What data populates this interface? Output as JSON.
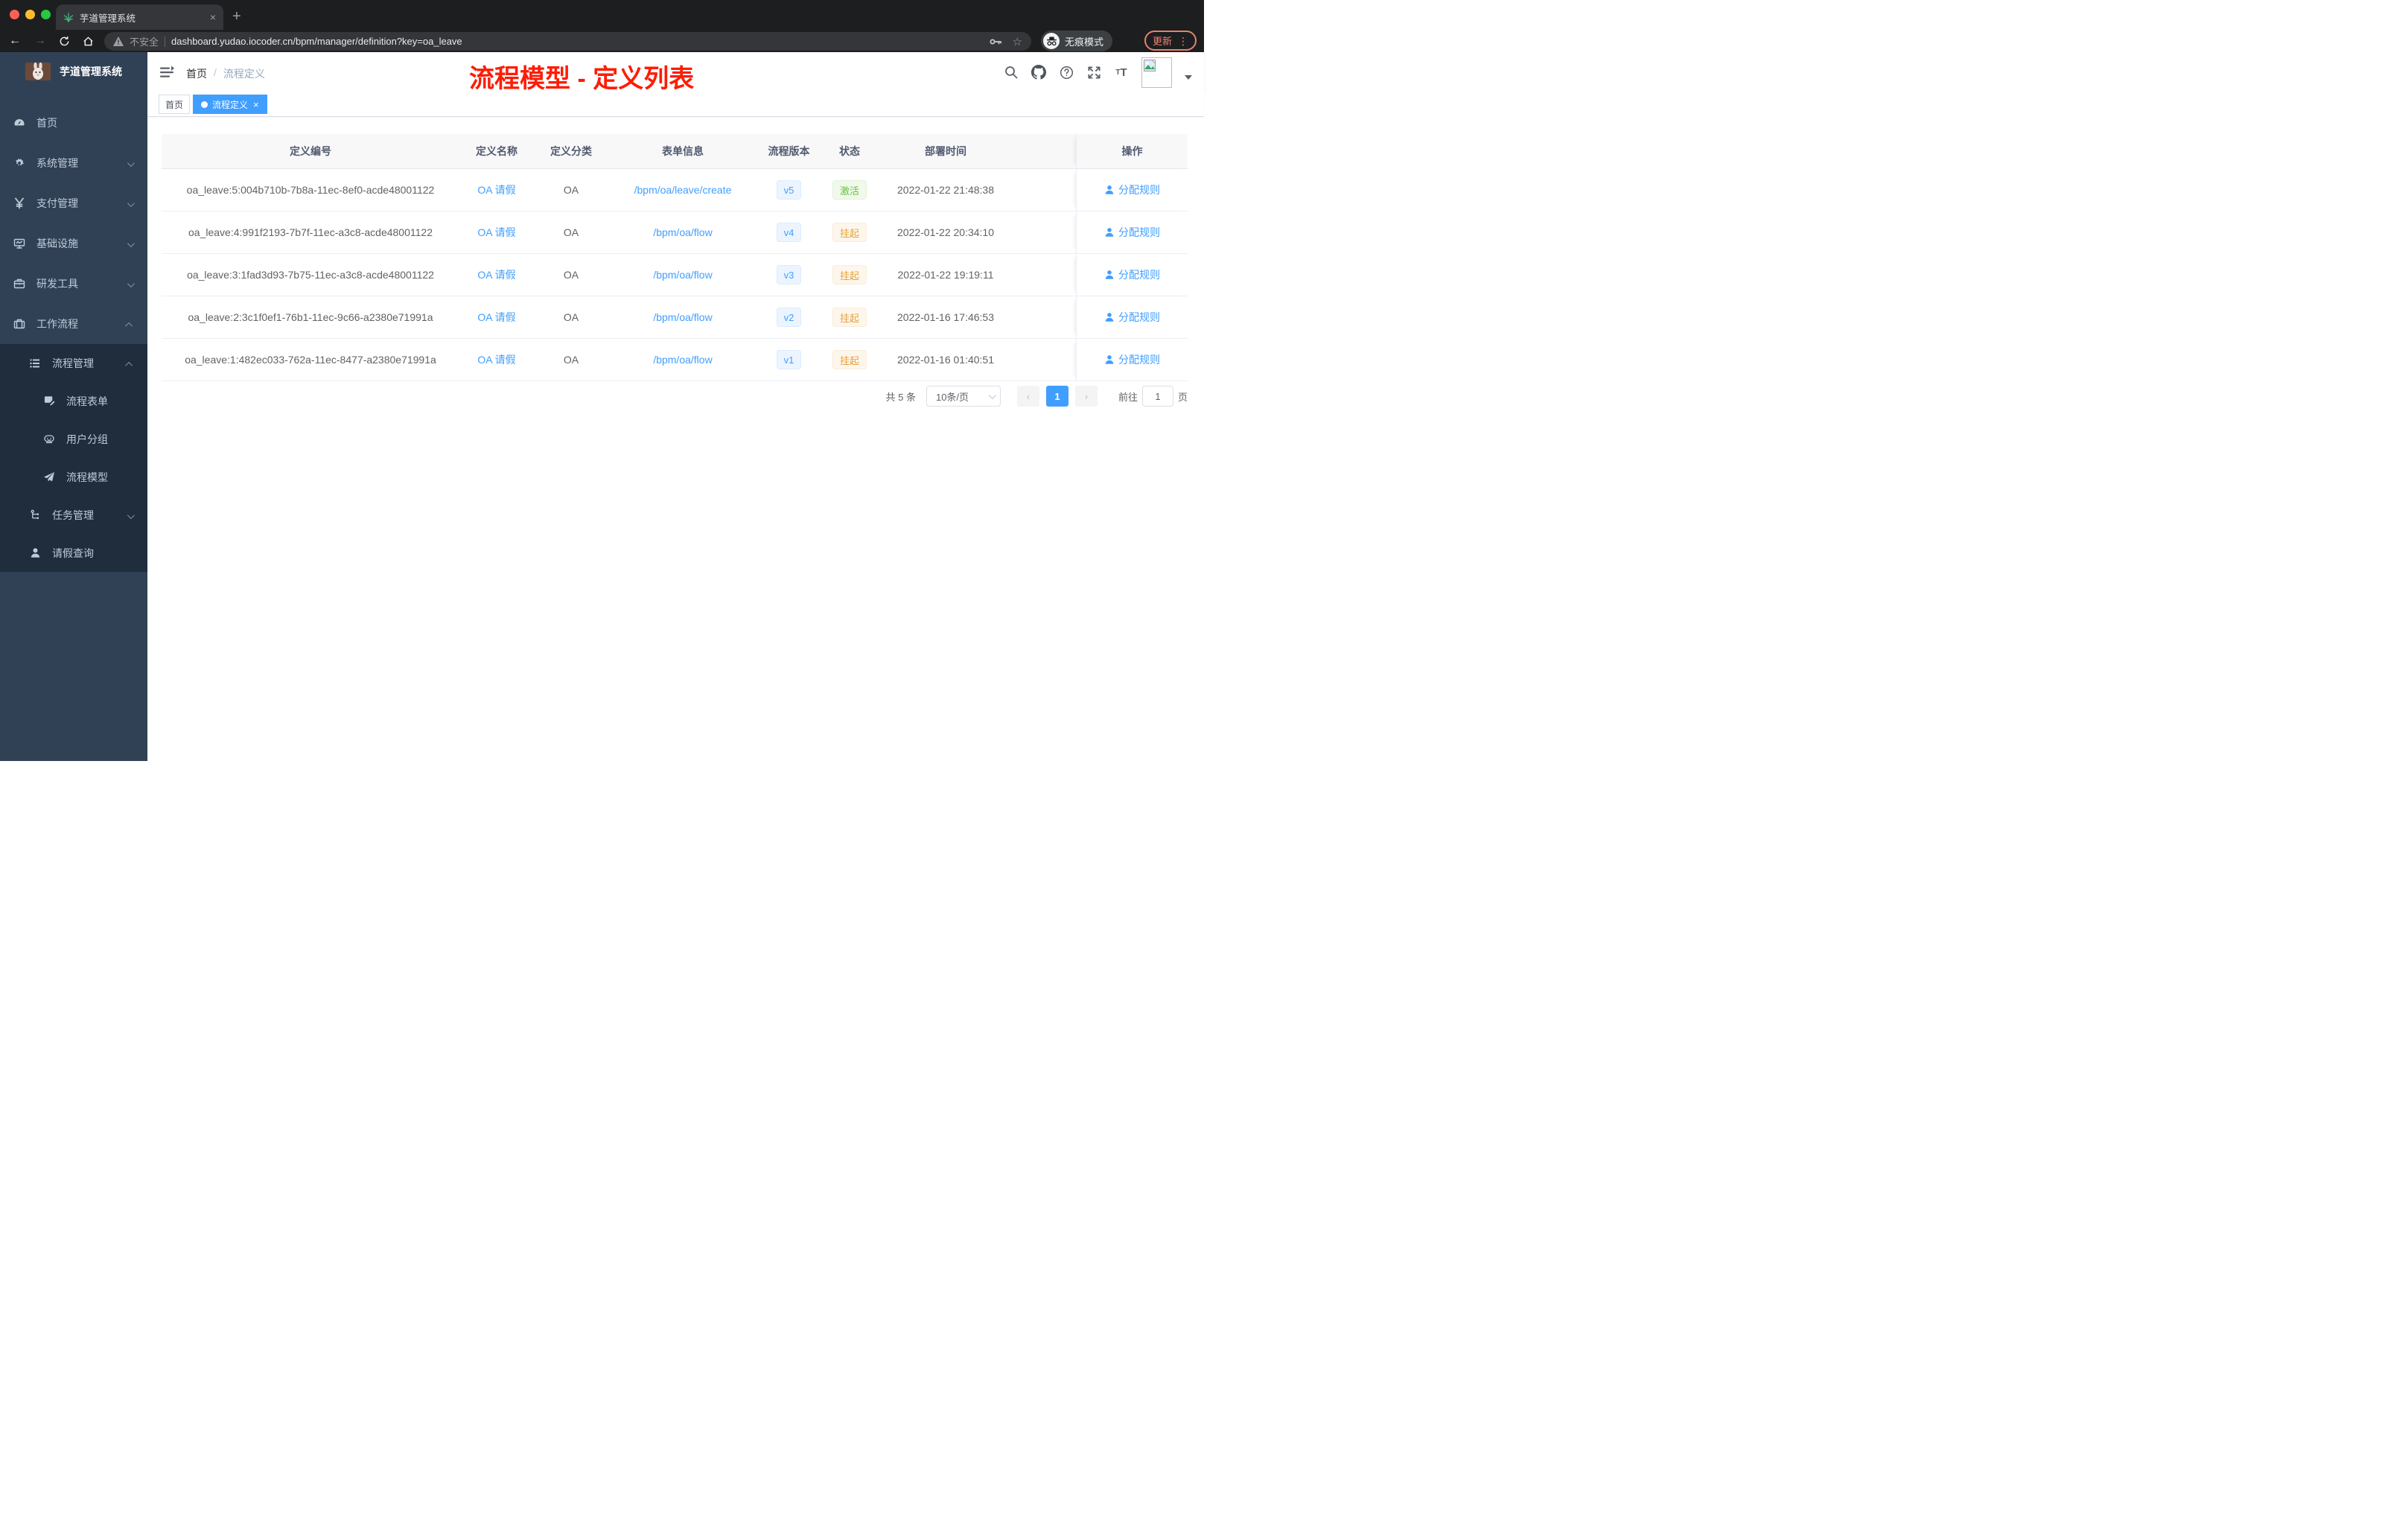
{
  "colors": {
    "primary": "#409eff",
    "success": "#67c23a",
    "warning": "#e6a23c",
    "annotation_red": "#fe1c05",
    "sidebar_bg": "#304156",
    "submenu_bg": "#1f2d3d",
    "sidebar_text": "#bfcbd9"
  },
  "browser": {
    "tab": {
      "title": "芋道管理系统",
      "favicon": "plant-icon",
      "close_label": "×"
    },
    "new_tab_label": "+",
    "back_label": "←",
    "forward_label": "→",
    "security_label": "不安全",
    "url": "dashboard.yudao.iocoder.cn/bpm/manager/definition?key=oa_leave",
    "incognito_label": "无痕模式",
    "update_label": "更新",
    "kebab_label": "⋮",
    "star_label": "☆"
  },
  "sidebar": {
    "logo_title": "芋道管理系统",
    "menu": [
      {
        "label": "首页",
        "icon": "dashboard-icon",
        "level": 1,
        "arrow": "",
        "dark": false
      },
      {
        "label": "系统管理",
        "icon": "gear-icon",
        "level": 1,
        "arrow": "down",
        "dark": false
      },
      {
        "label": "支付管理",
        "icon": "yen-icon",
        "level": 1,
        "arrow": "down",
        "dark": false
      },
      {
        "label": "基础设施",
        "icon": "monitor-icon",
        "level": 1,
        "arrow": "down",
        "dark": false
      },
      {
        "label": "研发工具",
        "icon": "toolbox-icon",
        "level": 1,
        "arrow": "down",
        "dark": false
      },
      {
        "label": "工作流程",
        "icon": "briefcase-icon",
        "level": 1,
        "arrow": "up",
        "dark": false
      },
      {
        "label": "流程管理",
        "icon": "list-tree-icon",
        "level": 2,
        "arrow": "up",
        "dark": true
      },
      {
        "label": "流程表单",
        "icon": "form-edit-icon",
        "level": 3,
        "arrow": "",
        "dark": true
      },
      {
        "label": "用户分组",
        "icon": "robot-icon",
        "level": 3,
        "arrow": "",
        "dark": true
      },
      {
        "label": "流程模型",
        "icon": "paper-plane-icon",
        "level": 3,
        "arrow": "",
        "dark": true
      },
      {
        "label": "任务管理",
        "icon": "org-tree-icon",
        "level": 2,
        "arrow": "down",
        "dark": true
      },
      {
        "label": "请假查询",
        "icon": "user-icon",
        "level": 2,
        "arrow": "",
        "dark": true
      }
    ]
  },
  "navbar": {
    "breadcrumb": {
      "home": "首页",
      "separator": "/",
      "current": "流程定义"
    },
    "annotation": "流程模型 - 定义列表",
    "icons": [
      "search-icon",
      "github-icon",
      "question-icon",
      "fullscreen-icon",
      "font-size-icon",
      "avatar",
      "caret-down-icon"
    ]
  },
  "tags_view": [
    {
      "label": "首页",
      "active": false,
      "closable": false
    },
    {
      "label": "流程定义",
      "active": true,
      "closable": true
    }
  ],
  "table": {
    "columns": [
      "定义编号",
      "定义名称",
      "定义分类",
      "表单信息",
      "流程版本",
      "状态",
      "部署时间",
      "操作"
    ],
    "rows": [
      {
        "id": "oa_leave:5:004b710b-7b8a-11ec-8ef0-acde48001122",
        "name": "OA 请假",
        "category": "OA",
        "form": "/bpm/oa/leave/create",
        "version": "v5",
        "status": "激活",
        "status_type": "success",
        "deployed_at": "2022-01-22 21:48:38",
        "action": "分配规则"
      },
      {
        "id": "oa_leave:4:991f2193-7b7f-11ec-a3c8-acde48001122",
        "name": "OA 请假",
        "category": "OA",
        "form": "/bpm/oa/flow",
        "version": "v4",
        "status": "挂起",
        "status_type": "warning",
        "deployed_at": "2022-01-22 20:34:10",
        "action": "分配规则"
      },
      {
        "id": "oa_leave:3:1fad3d93-7b75-11ec-a3c8-acde48001122",
        "name": "OA 请假",
        "category": "OA",
        "form": "/bpm/oa/flow",
        "version": "v3",
        "status": "挂起",
        "status_type": "warning",
        "deployed_at": "2022-01-22 19:19:11",
        "action": "分配规则"
      },
      {
        "id": "oa_leave:2:3c1f0ef1-76b1-11ec-9c66-a2380e71991a",
        "name": "OA 请假",
        "category": "OA",
        "form": "/bpm/oa/flow",
        "version": "v2",
        "status": "挂起",
        "status_type": "warning",
        "deployed_at": "2022-01-16 17:46:53",
        "action": "分配规则"
      },
      {
        "id": "oa_leave:1:482ec033-762a-11ec-8477-a2380e71991a",
        "name": "OA 请假",
        "category": "OA",
        "form": "/bpm/oa/flow",
        "version": "v1",
        "status": "挂起",
        "status_type": "warning",
        "deployed_at": "2022-01-16 01:40:51",
        "action": "分配规则"
      }
    ]
  },
  "pagination": {
    "total": "共 5 条",
    "page_size": "10条/页",
    "current_page": "1",
    "goto_label": "前往",
    "goto_value": "1",
    "page_unit": "页"
  }
}
